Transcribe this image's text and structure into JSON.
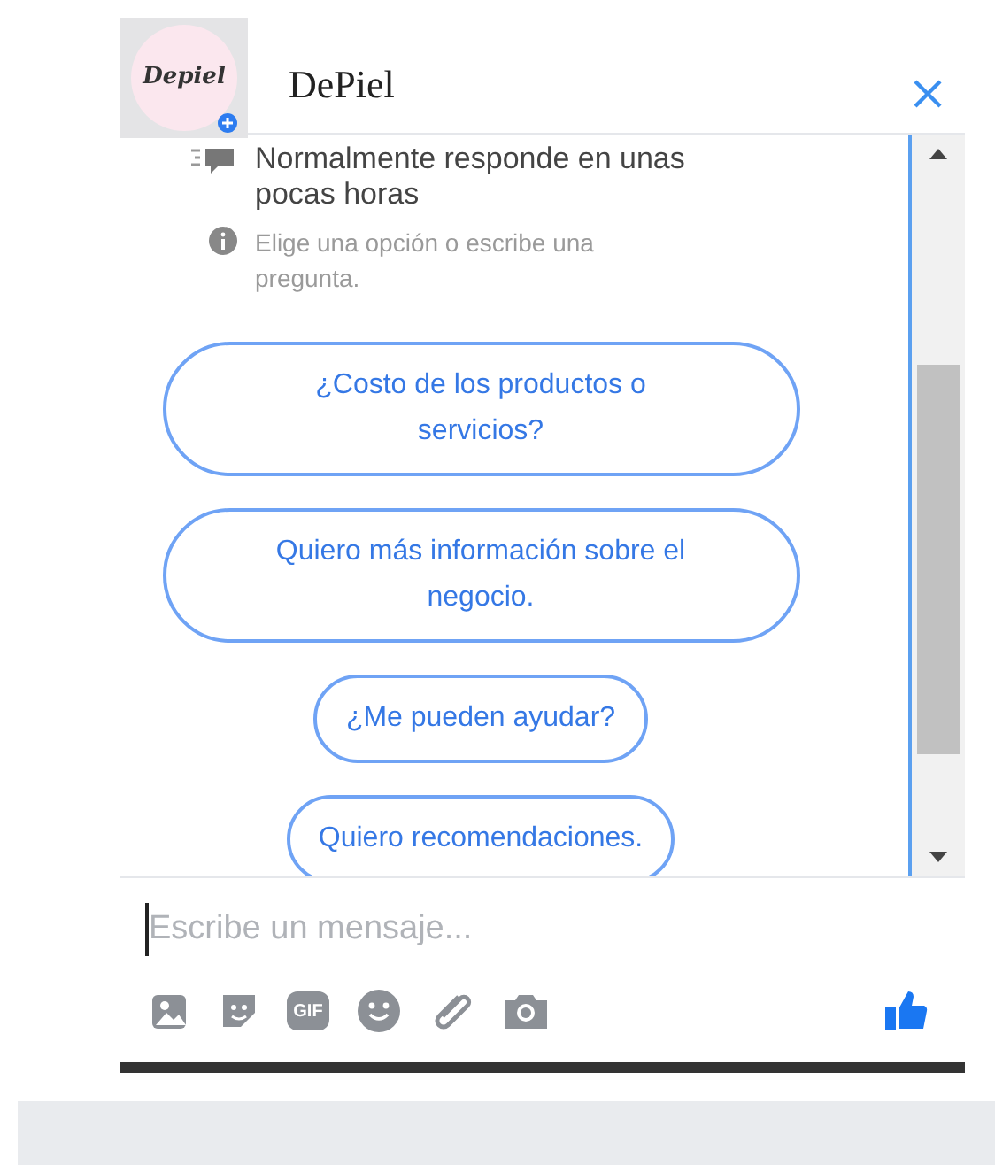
{
  "header": {
    "avatar_text": "Depiel",
    "title": "DePiel"
  },
  "info": [
    {
      "kind": "response",
      "text": "Normalmente responde en unas pocas horas"
    },
    {
      "kind": "hint",
      "text": "Elige una opción o escribe una pregunta."
    }
  ],
  "quick_replies": [
    {
      "label": "¿Costo de los productos o servicios?",
      "wide": true
    },
    {
      "label": "Quiero más información sobre el negocio.",
      "wide": true
    },
    {
      "label": "¿Me pueden ayudar?",
      "wide": false
    },
    {
      "label": "Quiero recomendaciones.",
      "wide": false
    }
  ],
  "composer": {
    "placeholder": "Escribe un mensaje...",
    "gif_label": "GIF"
  }
}
